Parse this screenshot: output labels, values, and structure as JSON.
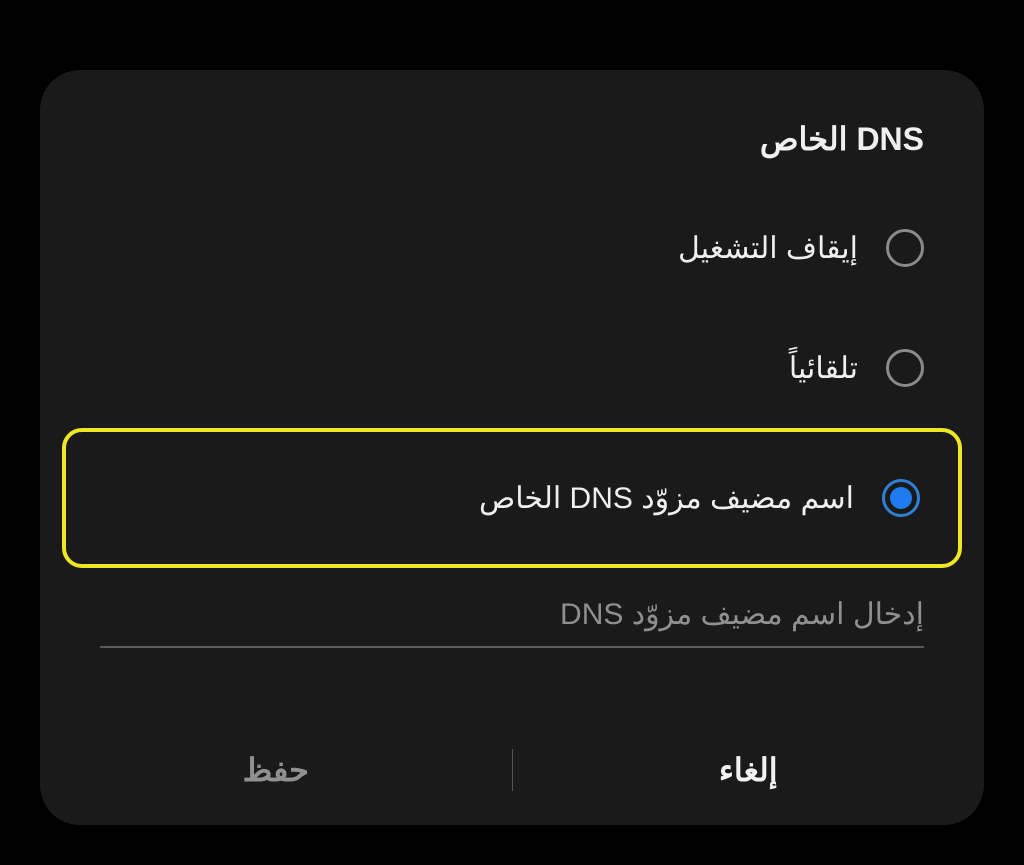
{
  "dialog": {
    "title": "DNS الخاص",
    "options": [
      {
        "id": "off",
        "label": "إيقاف التشغيل",
        "selected": false,
        "highlighted": false
      },
      {
        "id": "auto",
        "label": "تلقائياً",
        "selected": false,
        "highlighted": false
      },
      {
        "id": "hostname",
        "label": "اسم مضيف مزوّد DNS الخاص",
        "selected": true,
        "highlighted": true
      }
    ],
    "input": {
      "value": "",
      "placeholder": "إدخال اسم مضيف مزوّد DNS"
    },
    "buttons": {
      "cancel": "إلغاء",
      "save": "حفظ"
    },
    "colors": {
      "accent": "#1e7cf0",
      "highlight_border": "#ece826"
    }
  }
}
